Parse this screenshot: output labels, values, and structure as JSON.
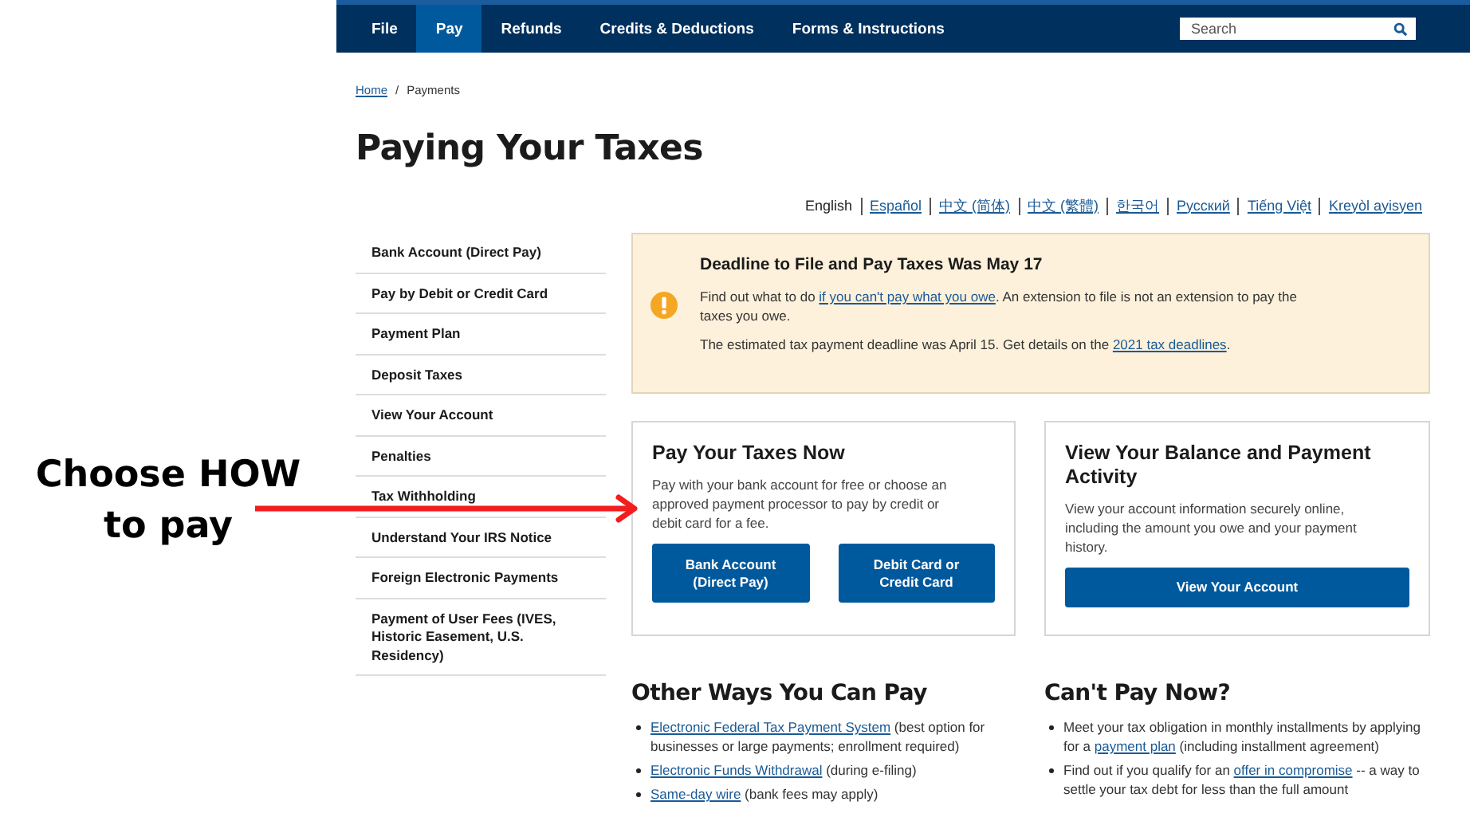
{
  "annotation": {
    "text": "Choose HOW to pay"
  },
  "nav": {
    "items": [
      {
        "label": "File",
        "selected": false
      },
      {
        "label": "Pay",
        "selected": true
      },
      {
        "label": "Refunds",
        "selected": false
      },
      {
        "label": "Credits & Deductions",
        "selected": false
      },
      {
        "label": "Forms & Instructions",
        "selected": false
      }
    ],
    "search": {
      "placeholder": "Search"
    }
  },
  "breadcrumb": {
    "items": [
      "Home",
      "Payments"
    ],
    "separator": "/"
  },
  "title": "Paying Your Taxes",
  "languages": [
    {
      "label": "English",
      "selected": true
    },
    {
      "label": "Español",
      "selected": false
    },
    {
      "label": "中文 (简体)",
      "selected": false
    },
    {
      "label": "中文 (繁體)",
      "selected": false
    },
    {
      "label": "한국어",
      "selected": false
    },
    {
      "label": "Русский",
      "selected": false
    },
    {
      "label": "Tiếng Việt",
      "selected": false
    },
    {
      "label": "Kreyòl ayisyen",
      "selected": false
    }
  ],
  "sidebar": {
    "items": [
      "Bank Account (Direct Pay)",
      "Pay by Debit or Credit Card",
      "Payment Plan",
      "Deposit Taxes",
      "View Your Account",
      "Penalties",
      "Tax Withholding",
      "Understand Your IRS Notice",
      "Foreign Electronic Payments",
      "Payment of User Fees (IVES, Historic Easement, U.S. Residency)"
    ]
  },
  "alert": {
    "title": "Deadline to File and Pay Taxes Was May 17",
    "paragraphs": [
      [
        {
          "text": "Find out what to do "
        },
        {
          "text": "if you can't pay what you owe",
          "link": true
        },
        {
          "text": ". An extension to file is not an extension to pay the taxes you owe."
        }
      ],
      [
        {
          "text": "The estimated tax payment deadline was April 15. Get details on the "
        },
        {
          "text": "2021 tax deadlines",
          "link": true
        },
        {
          "text": "."
        }
      ]
    ]
  },
  "cards": [
    {
      "title": "Pay Your Taxes Now",
      "text": "Pay with your bank account for free or choose an approved payment processor to pay by credit or debit card for a fee.",
      "buttons": [
        "Bank Account (Direct Pay)",
        "Debit Card or Credit Card"
      ]
    },
    {
      "title": "View Your Balance and Payment Activity",
      "text": "View your account information securely online, including the amount you owe and your payment history.",
      "buttons": [
        "View Your Account"
      ]
    }
  ],
  "sections": [
    {
      "title": "Other Ways You Can Pay",
      "items": [
        [
          {
            "text": "Electronic Federal Tax Payment System",
            "link": true
          },
          {
            "text": " (best option for businesses or large payments; enrollment required)"
          }
        ],
        [
          {
            "text": "Electronic Funds Withdrawal",
            "link": true
          },
          {
            "text": " (during e-filing)"
          }
        ],
        [
          {
            "text": "Same-day wire",
            "link": true
          },
          {
            "text": " (bank fees may apply)"
          }
        ]
      ]
    },
    {
      "title": "Can't Pay Now?",
      "items": [
        [
          {
            "text": "Meet your tax obligation in monthly installments by applying for a "
          },
          {
            "text": "payment plan",
            "link": true
          },
          {
            "text": " (including installment agreement)"
          }
        ],
        [
          {
            "text": "Find out if you qualify for an "
          },
          {
            "text": "offer in compromise",
            "link": true
          },
          {
            "text": " -- a way to settle your tax debt for less than the full amount"
          }
        ]
      ]
    }
  ]
}
